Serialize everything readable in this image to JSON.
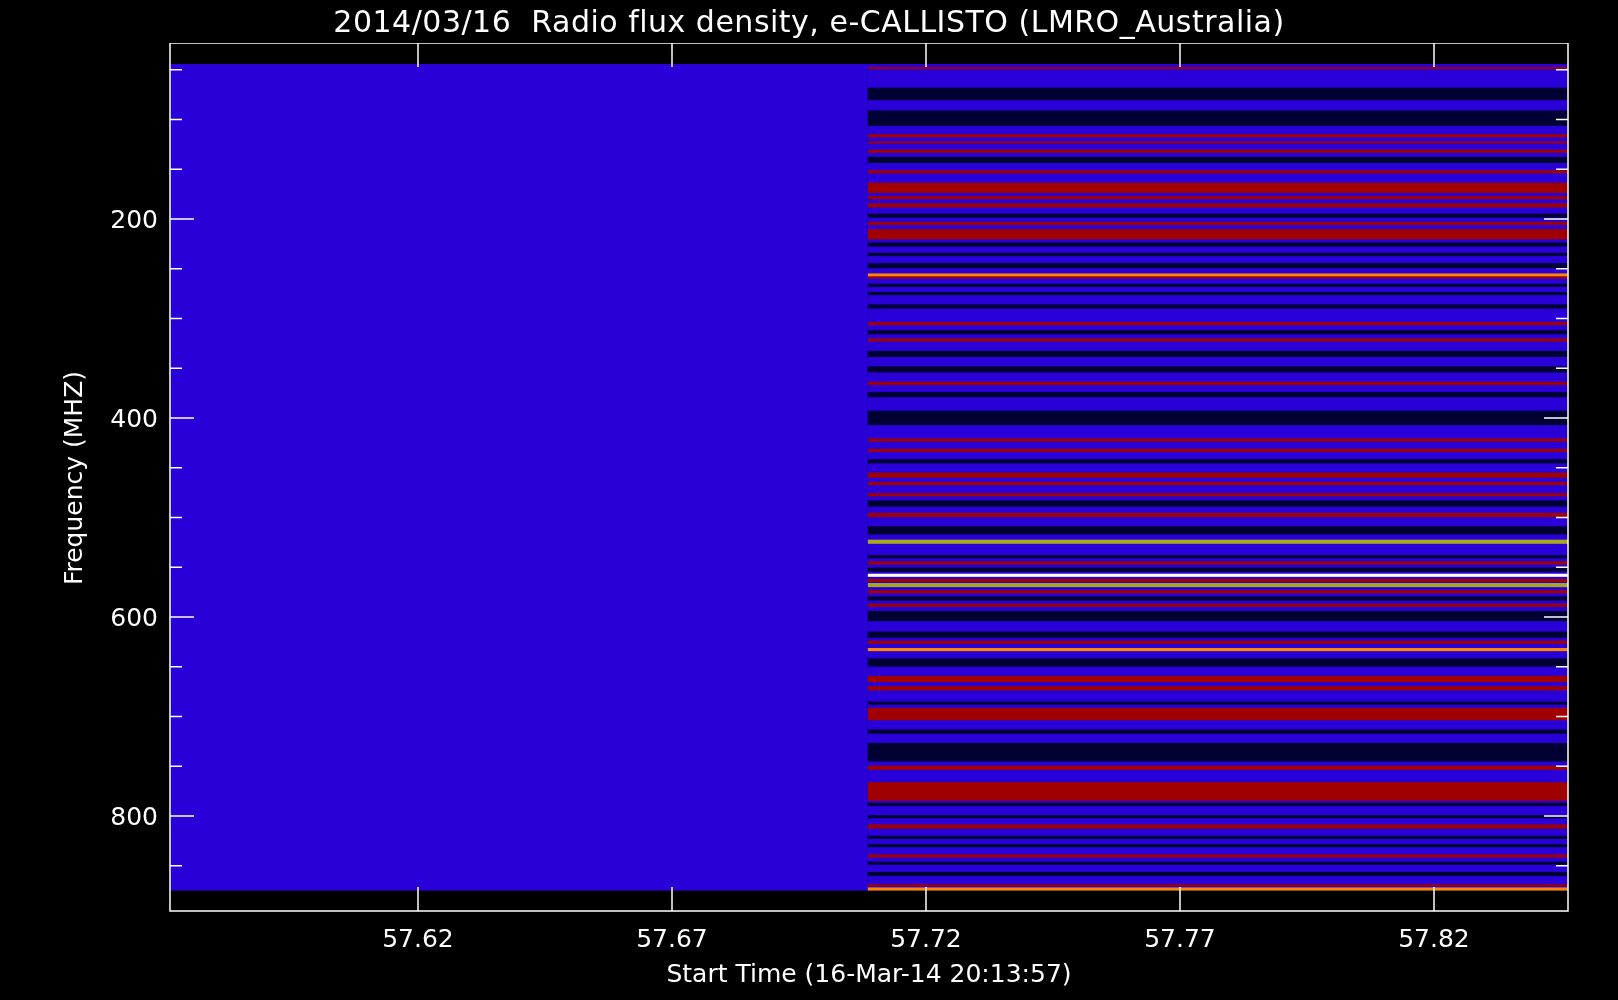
{
  "title": "2014/03/16  Radio flux density, e-CALLISTO (LMRO_Australia)",
  "y_axis": {
    "label": "Frequency (MHZ)",
    "ticks": [
      "200",
      "400",
      "600",
      "800"
    ]
  },
  "x_axis": {
    "label": "Start Time (16-Mar-14 20:13:57)",
    "ticks": [
      "57.62",
      "57.67",
      "57.72",
      "57.77",
      "57.82"
    ]
  }
}
